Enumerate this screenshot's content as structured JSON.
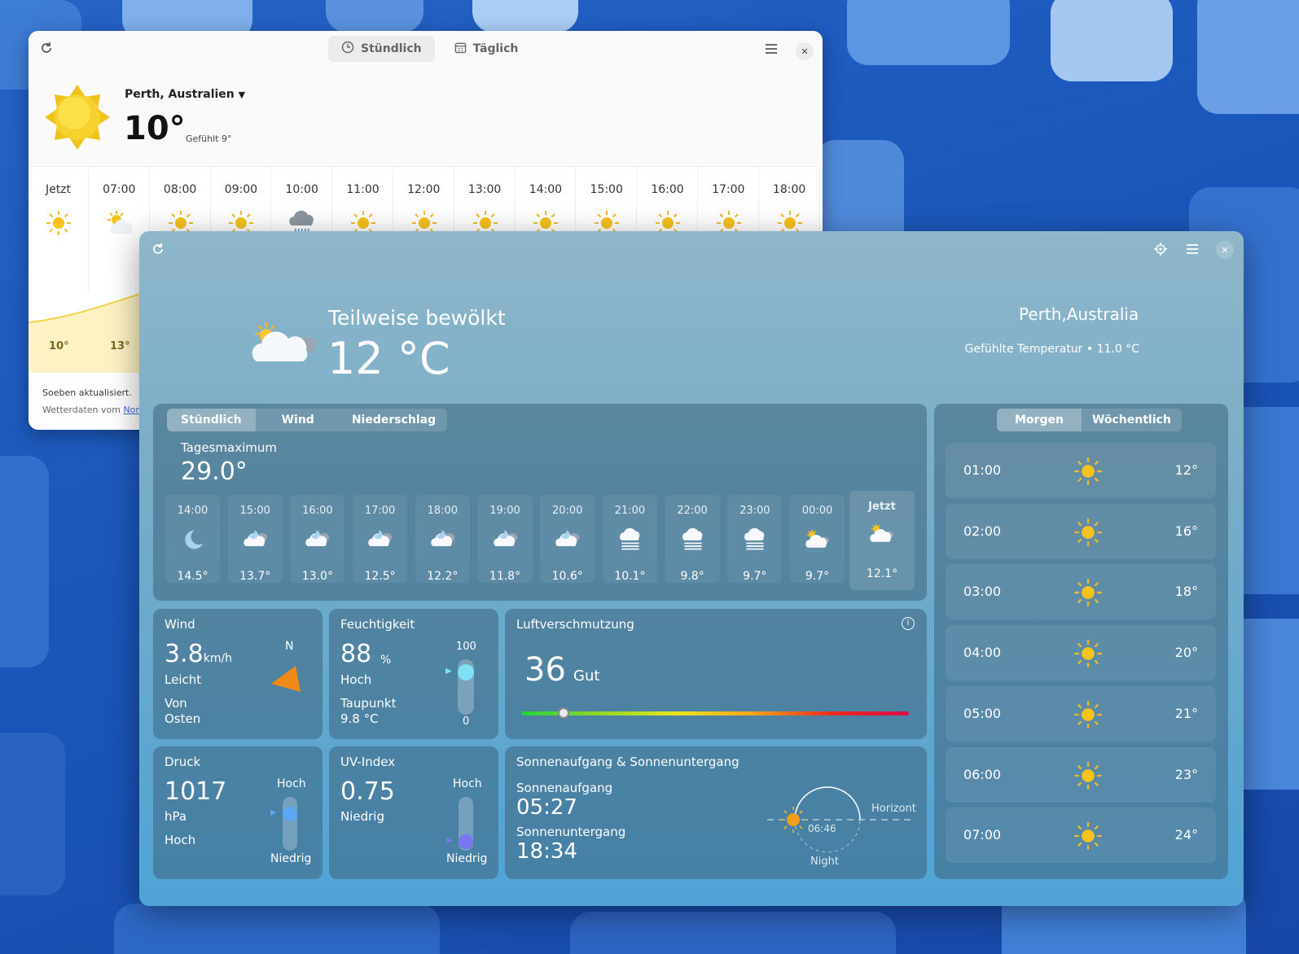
{
  "back_window": {
    "tabs": [
      {
        "label": "Stündlich",
        "icon": "clock-icon"
      },
      {
        "label": "Täglich",
        "icon": "calendar-icon"
      }
    ],
    "location": "Perth, Australien",
    "temperature": "10°",
    "feels_like": "Gefühlt 9°",
    "hours": [
      {
        "time": "Jetzt",
        "icon": "sun"
      },
      {
        "time": "07:00",
        "icon": "sun-cloud"
      },
      {
        "time": "08:00",
        "icon": "sun"
      },
      {
        "time": "09:00",
        "icon": "sun"
      },
      {
        "time": "10:00",
        "icon": "rain"
      },
      {
        "time": "11:00",
        "icon": "sun"
      },
      {
        "time": "12:00",
        "icon": "sun"
      },
      {
        "time": "13:00",
        "icon": "sun"
      },
      {
        "time": "14:00",
        "icon": "sun"
      },
      {
        "time": "15:00",
        "icon": "sun"
      },
      {
        "time": "16:00",
        "icon": "sun"
      },
      {
        "time": "17:00",
        "icon": "sun"
      },
      {
        "time": "18:00",
        "icon": "sun"
      }
    ],
    "chart_temps": [
      "10°",
      "13°"
    ],
    "updated": "Soeben aktualisiert.",
    "source_prefix": "Wetterdaten vom ",
    "source_link": "Norw"
  },
  "front_window": {
    "condition": "Teilweise bewölkt",
    "temperature": "12 °C",
    "city": "Perth,Australia",
    "feels_like": "Gefühlte Temperatur • 11.0 °C",
    "hourly_tabs": [
      "Stündlich",
      "Wind",
      "Niederschlag"
    ],
    "day_max_label": "Tagesmaximum",
    "day_max_value": "29.0°",
    "hourly": [
      {
        "time": "14:00",
        "value": "14.5°",
        "icon": "moon"
      },
      {
        "time": "15:00",
        "value": "13.7°",
        "icon": "moon-cloud"
      },
      {
        "time": "16:00",
        "value": "13.0°",
        "icon": "moon-cloud"
      },
      {
        "time": "17:00",
        "value": "12.5°",
        "icon": "moon-cloud"
      },
      {
        "time": "18:00",
        "value": "12.2°",
        "icon": "moon-cloud"
      },
      {
        "time": "19:00",
        "value": "11.8°",
        "icon": "moon-cloud"
      },
      {
        "time": "20:00",
        "value": "10.6°",
        "icon": "moon-cloud"
      },
      {
        "time": "21:00",
        "value": "10.1°",
        "icon": "fog"
      },
      {
        "time": "22:00",
        "value": "9.8°",
        "icon": "fog"
      },
      {
        "time": "23:00",
        "value": "9.7°",
        "icon": "fog"
      },
      {
        "time": "00:00",
        "value": "9.7°",
        "icon": "sun-cloud"
      },
      {
        "time": "Jetzt",
        "value": "12.1°",
        "icon": "sun-cloud"
      }
    ],
    "wind": {
      "title": "Wind",
      "speed": "3.8",
      "unit": "km/h",
      "desc": "Leicht",
      "from_label": "Von",
      "from": "Osten",
      "direction": "N"
    },
    "humidity": {
      "title": "Feuchtigkeit",
      "value": "88",
      "unit": "%",
      "level": "Hoch",
      "dew_label": "Taupunkt",
      "dew": "9.8 °C",
      "max": "100",
      "min": "0",
      "fraction": 0.88
    },
    "air": {
      "title": "Luftverschmutzung",
      "value": "36",
      "label": "Gut",
      "fraction": 0.11
    },
    "pressure": {
      "title": "Druck",
      "value": "1017",
      "unit": "hPa",
      "level": "Hoch",
      "high": "Hoch",
      "low": "Niedrig",
      "fraction": 0.75
    },
    "uv": {
      "title": "UV-Index",
      "value": "0.75",
      "level": "Niedrig",
      "high": "Hoch",
      "low": "Niedrig",
      "fraction": 0.05
    },
    "sun": {
      "title": "Sonnenaufgang & Sonnenuntergang",
      "rise_label": "Sonnenaufgang",
      "rise": "05:27",
      "set_label": "Sonnenuntergang",
      "set": "18:34",
      "horizon": "Horizont",
      "night": "Night",
      "mid": "06:46"
    },
    "forecast_tabs": [
      "Morgen",
      "Wöchentlich"
    ],
    "forecast": [
      {
        "time": "01:00",
        "value": "12°"
      },
      {
        "time": "02:00",
        "value": "16°"
      },
      {
        "time": "03:00",
        "value": "18°"
      },
      {
        "time": "04:00",
        "value": "20°"
      },
      {
        "time": "05:00",
        "value": "21°"
      },
      {
        "time": "06:00",
        "value": "23°"
      },
      {
        "time": "07:00",
        "value": "24°"
      }
    ],
    "colors": {
      "accent_sun": "#f7c21c",
      "wind_arrow": "#f08a16",
      "bar_fill": "#7fe0f5",
      "uv_fill": "#7a76f0"
    }
  }
}
